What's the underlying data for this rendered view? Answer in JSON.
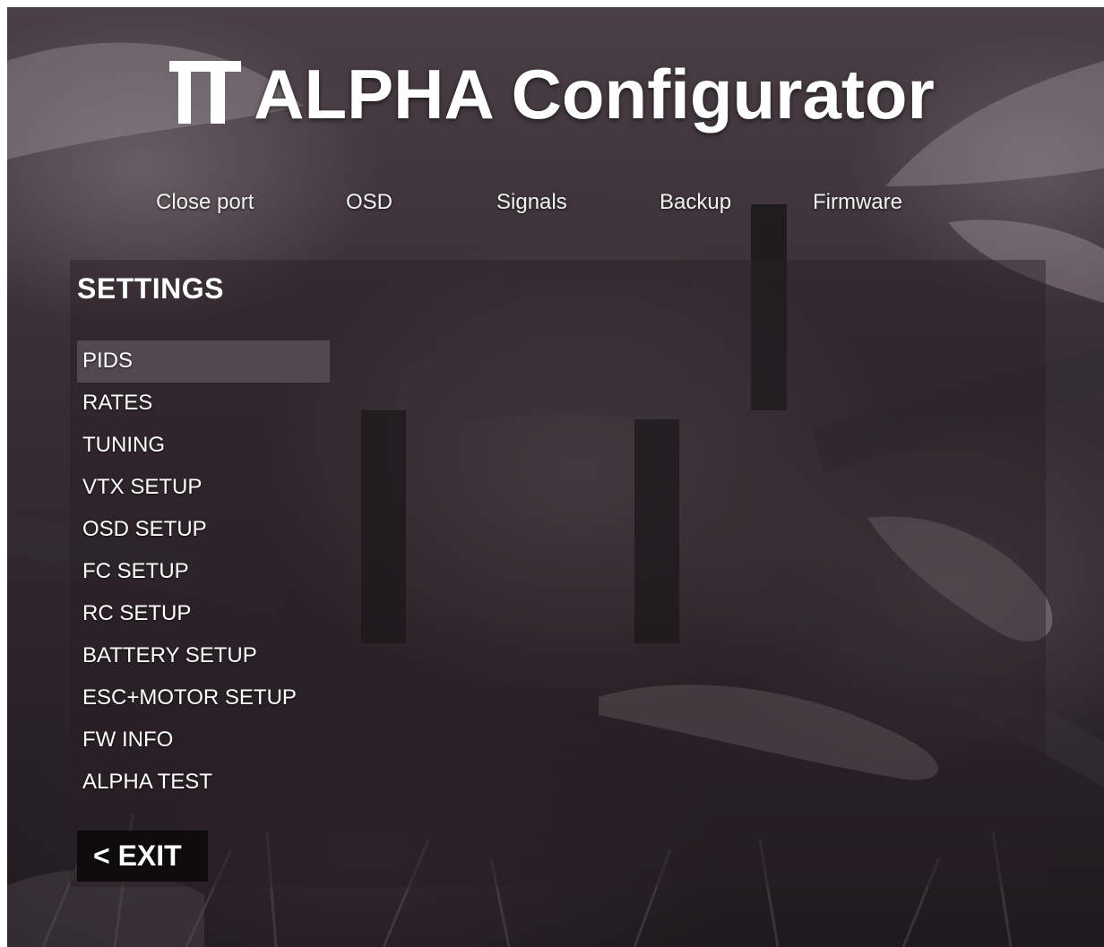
{
  "app": {
    "title": "ALPHA Configurator",
    "logo_icon": "tt-logo-icon"
  },
  "nav": {
    "items": [
      {
        "label": "Close port"
      },
      {
        "label": "OSD"
      },
      {
        "label": "Signals"
      },
      {
        "label": "Backup"
      },
      {
        "label": "Firmware"
      }
    ]
  },
  "settings": {
    "title": "SETTINGS",
    "active_item": "PIDS",
    "items": [
      {
        "label": "PIDS"
      },
      {
        "label": "RATES"
      },
      {
        "label": "TUNING"
      },
      {
        "label": "VTX SETUP"
      },
      {
        "label": "OSD SETUP"
      },
      {
        "label": "FC SETUP"
      },
      {
        "label": "RC SETUP"
      },
      {
        "label": "BATTERY SETUP"
      },
      {
        "label": "ESC+MOTOR SETUP"
      },
      {
        "label": "FW INFO"
      },
      {
        "label": "ALPHA TEST"
      }
    ],
    "exit_label": "< EXIT"
  },
  "colors": {
    "text": "#ffffff",
    "active_item_bg": "#6e646c",
    "exit_bg": "#0d0b0c",
    "background_top": "#4a3f45",
    "background_bottom": "#1f1a1d"
  }
}
